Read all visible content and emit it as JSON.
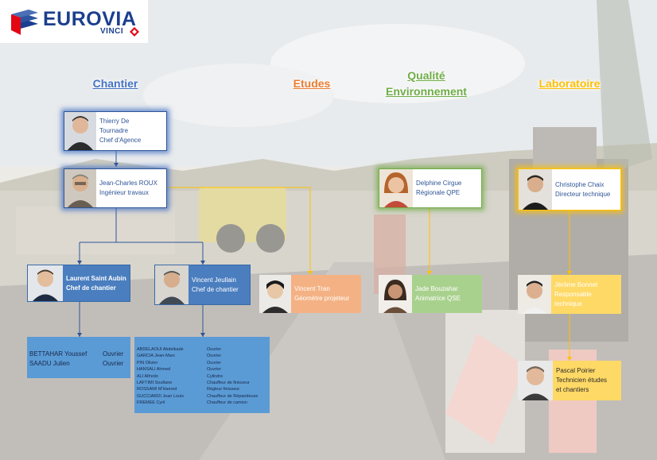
{
  "logo": {
    "word": "EUROVIA",
    "sub": "VINCI",
    "colors": {
      "brand": "#1b3f8f",
      "accent": "#e30613"
    }
  },
  "columns": [
    {
      "id": "chantier",
      "title": "Chantier",
      "color": "#4472c4"
    },
    {
      "id": "etudes",
      "title": "Etudes",
      "color": "#ed7d31"
    },
    {
      "id": "qualite",
      "title_line1": "Qualité",
      "title_line2": "Environnement",
      "color": "#70ad47"
    },
    {
      "id": "laboratoire",
      "title": "Laboratoire",
      "color": "#ffc000"
    }
  ],
  "people": {
    "tournadre": {
      "lines": [
        "Thierry De",
        "Tournadre",
        "Chef d'Agence"
      ]
    },
    "roux": {
      "lines": [
        "Jean-Charles ROUX",
        "Ingénieur travaux"
      ]
    },
    "saint_aubin": {
      "lines": [
        "Laurent Saint Aubin",
        "Chef de chantier"
      ]
    },
    "jeullain": {
      "lines": [
        "Vincent Jeullain",
        "Chef de chantier"
      ]
    },
    "tran": {
      "lines": [
        "Vincent Tran",
        "Géomètre projeteur"
      ]
    },
    "cirgue": {
      "lines": [
        "Delphine Cirgue",
        "Régionale QPE"
      ]
    },
    "bouzahar": {
      "lines": [
        "Jade Bouzahar",
        "Animatrice QSE"
      ]
    },
    "chaix": {
      "lines": [
        "Christophe Chaix",
        "Directeur technique"
      ]
    },
    "bonnet": {
      "lines": [
        "Jérôme Bonnet",
        "Responsable",
        "technique"
      ]
    },
    "poirier": {
      "lines": [
        "Pascal Poirier",
        "Technicien études",
        "et chantiers"
      ]
    }
  },
  "crew_small": [
    {
      "name": "BETTAHAR Youssef",
      "role": "Ouvrier"
    },
    {
      "name": "SAADU Julien",
      "role": "Ouvrier"
    }
  ],
  "crew_large": [
    {
      "name": "ABDELAOUI Abdelkade",
      "role": "Ouvrier"
    },
    {
      "name": "GARCIA Jean-Marc",
      "role": "Ouvrier"
    },
    {
      "name": "PIN Olivier",
      "role": "Ouvrier"
    },
    {
      "name": "HANSALI Ahmed",
      "role": "Ouvrier"
    },
    {
      "name": "ALI Alfredo",
      "role": "Cylindre"
    },
    {
      "name": "LAFTIMI Soufiane",
      "role": "Chauffeur de finisseur"
    },
    {
      "name": "ROSSAMI M'Hamed",
      "role": "Régleur finisseur"
    },
    {
      "name": "GUCCIARDI Jean Louis",
      "role": "Chauffeur de Répandeuse"
    },
    {
      "name": "FREMEE Cyril",
      "role": "Chauffeur de camion"
    }
  ]
}
